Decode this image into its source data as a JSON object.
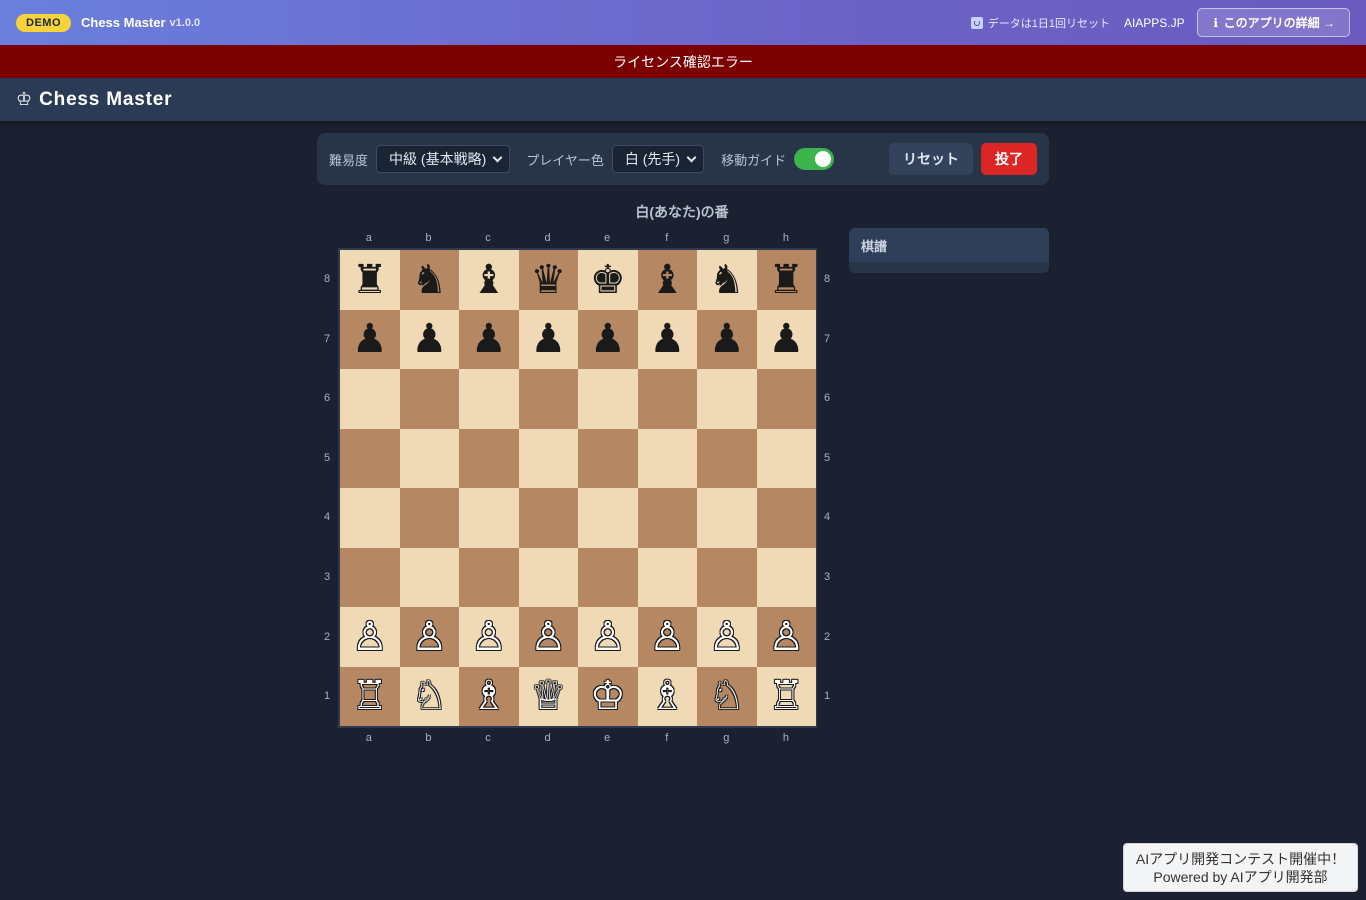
{
  "topbar": {
    "demo_badge": "DEMO",
    "app_name": "Chess Master",
    "version": "v1.0.0",
    "reset_note": "データは1日1回リセット",
    "site": "AIAPPS.JP",
    "detail_button": "このアプリの詳細 →"
  },
  "error_banner": "ライセンス確認エラー",
  "header": {
    "icon": "♔",
    "title": "Chess Master"
  },
  "controls": {
    "difficulty_label": "難易度",
    "difficulty_value": "中級 (基本戦略)",
    "player_color_label": "プレイヤー色",
    "player_color_value": "白 (先手)",
    "move_guide_label": "移動ガイド",
    "move_guide_enabled": true,
    "reset_button": "リセット",
    "resign_button": "投了"
  },
  "turn_text": "白(あなた)の番",
  "board": {
    "files": [
      "a",
      "b",
      "c",
      "d",
      "e",
      "f",
      "g",
      "h"
    ],
    "ranks": [
      "8",
      "7",
      "6",
      "5",
      "4",
      "3",
      "2",
      "1"
    ],
    "rows": [
      [
        "♜",
        "♞",
        "♝",
        "♛",
        "♚",
        "♝",
        "♞",
        "♜"
      ],
      [
        "♟",
        "♟",
        "♟",
        "♟",
        "♟",
        "♟",
        "♟",
        "♟"
      ],
      [
        "",
        "",
        "",
        "",
        "",
        "",
        "",
        ""
      ],
      [
        "",
        "",
        "",
        "",
        "",
        "",
        "",
        ""
      ],
      [
        "",
        "",
        "",
        "",
        "",
        "",
        "",
        ""
      ],
      [
        "",
        "",
        "",
        "",
        "",
        "",
        "",
        ""
      ],
      [
        "♙",
        "♙",
        "♙",
        "♙",
        "♙",
        "♙",
        "♙",
        "♙"
      ],
      [
        "♖",
        "♘",
        "♗",
        "♕",
        "♔",
        "♗",
        "♘",
        "♖"
      ]
    ],
    "light_color": "#f0d9b5",
    "dark_color": "#b58863"
  },
  "move_log": {
    "title": "棋譜"
  },
  "contest": {
    "line1": "AIアプリ開発コンテスト開催中！",
    "line2": "Powered by AIアプリ開発部"
  }
}
